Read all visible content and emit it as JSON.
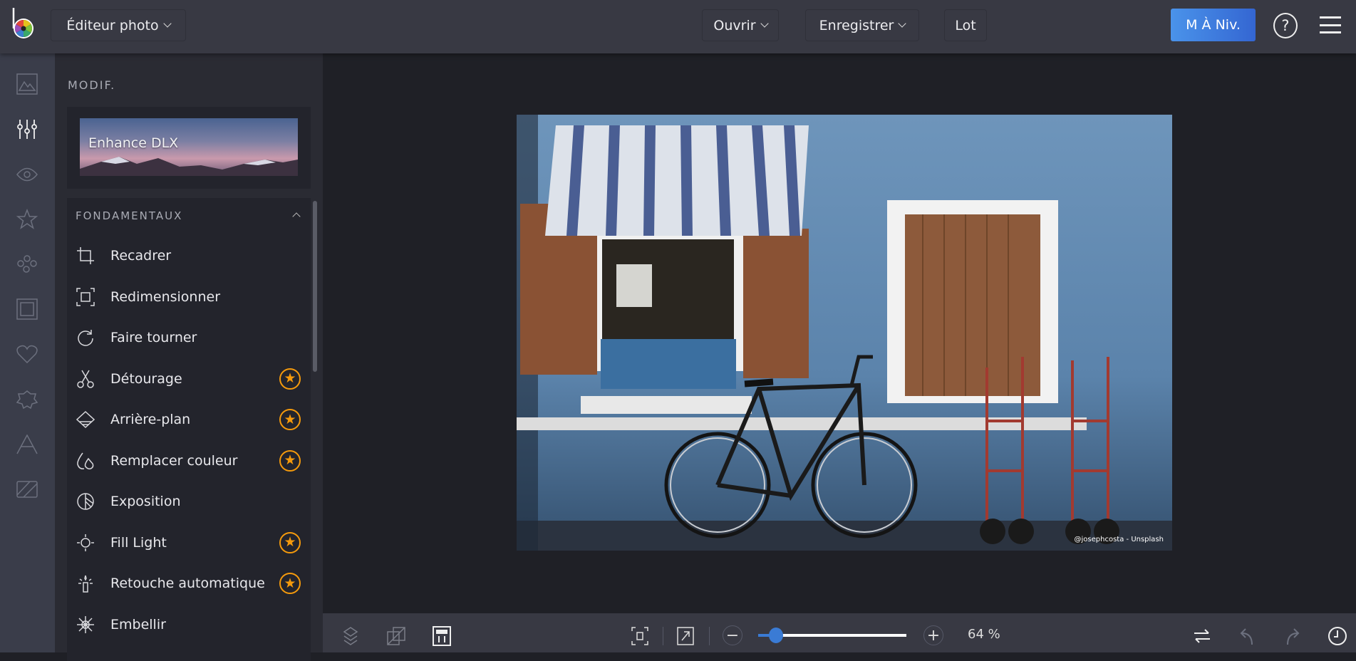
{
  "header": {
    "app_menu": "Éditeur photo",
    "open": "Ouvrir",
    "save": "Enregistrer",
    "batch": "Lot",
    "upgrade": "M À Niv.",
    "help_icon": "question-circle-icon",
    "menu_icon": "hamburger-icon"
  },
  "rail": {
    "icons": [
      "image-icon",
      "sliders-icon",
      "eye-icon",
      "star-icon",
      "circles-icon",
      "frame-icon",
      "heart-icon",
      "badge-icon",
      "text-icon",
      "texture-icon"
    ],
    "active": "sliders-icon"
  },
  "panel": {
    "title": "MODIF.",
    "promo": "Enhance DLX",
    "section": "FONDAMENTAUX",
    "items": [
      {
        "label": "Recadrer",
        "icon": "crop-icon",
        "premium": false
      },
      {
        "label": "Redimensionner",
        "icon": "resize-icon",
        "premium": false
      },
      {
        "label": "Faire tourner",
        "icon": "rotate-icon",
        "premium": false
      },
      {
        "label": "Détourage",
        "icon": "scissors-icon",
        "premium": true
      },
      {
        "label": "Arrière-plan",
        "icon": "background-icon",
        "premium": true
      },
      {
        "label": "Remplacer couleur",
        "icon": "drops-icon",
        "premium": true
      },
      {
        "label": "Exposition",
        "icon": "exposure-icon",
        "premium": false
      },
      {
        "label": "Fill Light",
        "icon": "sun-icon",
        "premium": true
      },
      {
        "label": "Retouche automatique",
        "icon": "magic-wand-icon",
        "premium": true
      },
      {
        "label": "Embellir",
        "icon": "snowflake-icon",
        "premium": false
      }
    ]
  },
  "canvas": {
    "watermark": "@josephcosta - Unsplash"
  },
  "footer": {
    "zoom_label": "64 %",
    "zoom_value": 64
  },
  "colors": {
    "accent": "#3a7bd5",
    "premium": "#f59a0c",
    "topbar": "#383943"
  }
}
